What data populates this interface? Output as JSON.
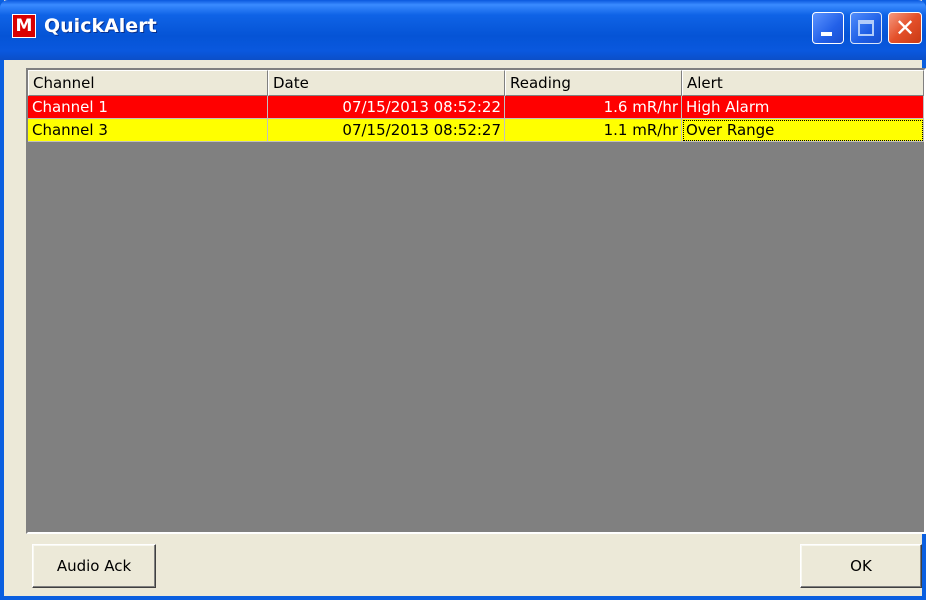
{
  "window": {
    "title": "QuickAlert",
    "icon_glyph": "M",
    "icon_name": "app-logo-icon",
    "colors": {
      "titlebar": "#0a58de",
      "face": "#ece9d8",
      "list_background": "#808080",
      "alarm_row": "#ff0000",
      "warning_row": "#ffff00"
    }
  },
  "titlebar_buttons": {
    "minimize": "minimize-icon",
    "maximize": "maximize-icon",
    "close": "close-icon",
    "close_glyph": "✕"
  },
  "table": {
    "columns": [
      "Channel",
      "Date",
      "Reading",
      "Alert"
    ],
    "rows": [
      {
        "channel": "Channel 1",
        "date": "07/15/2013 08:52:22",
        "reading": "1.6 mR/hr",
        "alert": "High Alarm",
        "color": "#ff0000"
      },
      {
        "channel": "Channel 3",
        "date": "07/15/2013 08:52:27",
        "reading": "1.1 mR/hr",
        "alert": "Over Range",
        "color": "#ffff00"
      }
    ]
  },
  "buttons": {
    "audio_ack": "Audio Ack",
    "ok": "OK"
  }
}
